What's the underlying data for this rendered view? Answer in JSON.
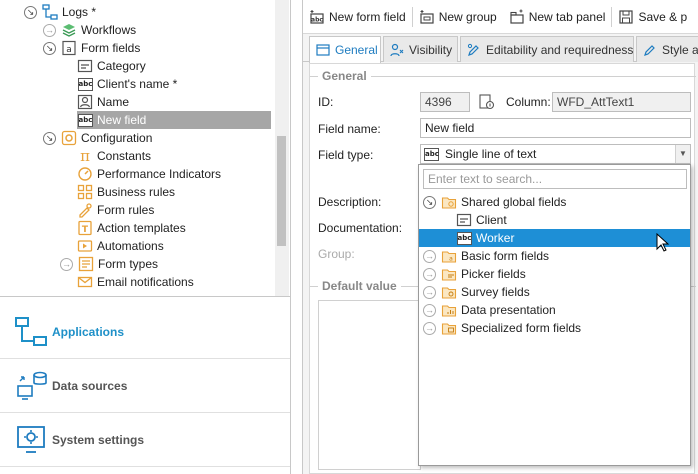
{
  "tree": {
    "items": [
      {
        "label": "Logs *"
      },
      {
        "label": "Workflows"
      },
      {
        "label": "Form fields"
      },
      {
        "label": "Category"
      },
      {
        "label": "Client's name *"
      },
      {
        "label": "Name"
      },
      {
        "label": "New field"
      },
      {
        "label": "Configuration"
      },
      {
        "label": "Constants"
      },
      {
        "label": "Performance Indicators"
      },
      {
        "label": "Business rules"
      },
      {
        "label": "Form rules"
      },
      {
        "label": "Action templates"
      },
      {
        "label": "Automations"
      },
      {
        "label": "Form types"
      },
      {
        "label": "Email notifications"
      }
    ]
  },
  "nav": {
    "applications": "Applications",
    "data_sources": "Data sources",
    "system_settings": "System settings"
  },
  "toolbar": {
    "new_form_field": "New form field",
    "new_group": "New group",
    "new_tab_panel": "New tab panel",
    "save": "Save & p"
  },
  "tabs": {
    "general": "General",
    "visibility": "Visibility",
    "editability": "Editability and requiredness",
    "style": "Style an"
  },
  "general": {
    "section_title": "General",
    "id_label": "ID:",
    "id_value": "4396",
    "column_label": "Column:",
    "column_value": "WFD_AttText1",
    "field_name_label": "Field name:",
    "field_name_value": "New field",
    "field_type_label": "Field type:",
    "field_type_value": "Single line of text",
    "description_label": "Description:",
    "documentation_label": "Documentation:",
    "group_label": "Group:"
  },
  "default_value": {
    "section_title": "Default value"
  },
  "dropdown": {
    "search_placeholder": "Enter text to search...",
    "items": [
      {
        "label": "Shared global fields"
      },
      {
        "label": "Client"
      },
      {
        "label": "Worker"
      },
      {
        "label": "Basic form fields"
      },
      {
        "label": "Picker fields"
      },
      {
        "label": "Survey fields"
      },
      {
        "label": "Data presentation"
      },
      {
        "label": "Specialized form fields"
      }
    ]
  },
  "colors": {
    "accent": "#1e90c8",
    "highlight": "#1e8fd6",
    "tree_selection": "#a6a6a6",
    "folder_icon": "#e8a23a"
  }
}
